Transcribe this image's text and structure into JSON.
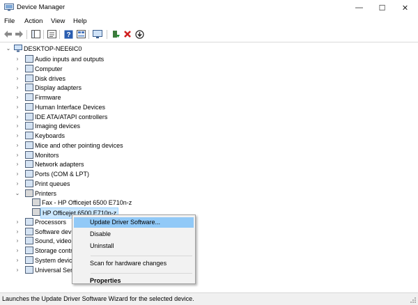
{
  "window": {
    "title": "Device Manager",
    "minimize_glyph": "—",
    "maximize_glyph": "☐",
    "close_glyph": "✕"
  },
  "menu": [
    "File",
    "Action",
    "View",
    "Help"
  ],
  "toolbar": {
    "icons": [
      "back-icon",
      "forward-icon",
      "console-tree-icon",
      "properties-icon",
      "help-icon",
      "view-resources-icon",
      "monitor-icon",
      "update-driver-icon",
      "uninstall-icon",
      "download-icon"
    ]
  },
  "tree": {
    "root": "DESKTOP-NEE6IC0",
    "items": [
      {
        "label": "Audio inputs and outputs",
        "icon": "speaker-icon",
        "expanded": false
      },
      {
        "label": "Computer",
        "icon": "computer-icon",
        "expanded": false
      },
      {
        "label": "Disk drives",
        "icon": "disk-drive-icon",
        "expanded": false
      },
      {
        "label": "Display adapters",
        "icon": "display-adapter-icon",
        "expanded": false
      },
      {
        "label": "Firmware",
        "icon": "firmware-icon",
        "expanded": false
      },
      {
        "label": "Human Interface Devices",
        "icon": "hid-icon",
        "expanded": false
      },
      {
        "label": "IDE ATA/ATAPI controllers",
        "icon": "ide-icon",
        "expanded": false
      },
      {
        "label": "Imaging devices",
        "icon": "camera-icon",
        "expanded": false
      },
      {
        "label": "Keyboards",
        "icon": "keyboard-icon",
        "expanded": false
      },
      {
        "label": "Mice and other pointing devices",
        "icon": "mouse-icon",
        "expanded": false
      },
      {
        "label": "Monitors",
        "icon": "monitor-icon",
        "expanded": false
      },
      {
        "label": "Network adapters",
        "icon": "network-icon",
        "expanded": false
      },
      {
        "label": "Ports (COM & LPT)",
        "icon": "port-icon",
        "expanded": false
      },
      {
        "label": "Print queues",
        "icon": "print-queue-icon",
        "expanded": false
      },
      {
        "label": "Printers",
        "icon": "printer-icon",
        "expanded": true
      },
      {
        "label": "Fax - HP Officejet 6500 E710n-z",
        "icon": "fax-icon",
        "child": true
      },
      {
        "label": "HP Officejet 6500 E710n-z",
        "icon": "printer-icon",
        "child": true,
        "selected": true
      },
      {
        "label": "Processors",
        "icon": "processor-icon",
        "expanded": false
      },
      {
        "label": "Software devices",
        "icon": "software-icon",
        "expanded": false
      },
      {
        "label": "Sound, video and game controllers",
        "icon": "sound-icon",
        "expanded": false
      },
      {
        "label": "Storage controllers",
        "icon": "storage-icon",
        "expanded": false
      },
      {
        "label": "System devices",
        "icon": "system-icon",
        "expanded": false
      },
      {
        "label": "Universal Serial Bus controllers",
        "icon": "usb-icon",
        "expanded": false
      }
    ]
  },
  "context_menu": {
    "items": [
      {
        "label": "Update Driver Software...",
        "highlighted": true
      },
      {
        "label": "Disable"
      },
      {
        "label": "Uninstall"
      },
      {
        "separator": true
      },
      {
        "label": "Scan for hardware changes"
      },
      {
        "separator": true
      },
      {
        "label": "Properties",
        "bold": true
      }
    ]
  },
  "status": {
    "text": "Launches the Update Driver Software Wizard for the selected device."
  },
  "colors": {
    "selection_bg": "#cce8ff",
    "menu_highlight": "#91c9f7",
    "uninstall_red": "#d01f1f",
    "update_green": "#1a8a2c",
    "help_blue": "#2a5db0"
  }
}
